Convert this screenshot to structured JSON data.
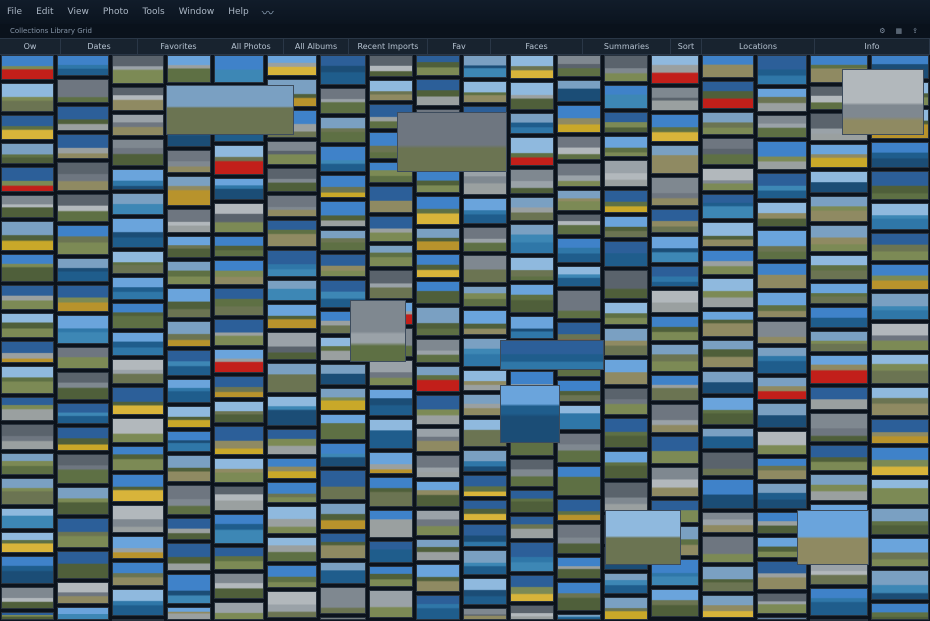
{
  "menu": [
    "File",
    "Edit",
    "View",
    "Photo",
    "Tools",
    "Window",
    "Help"
  ],
  "infobar": {
    "status": "Collections  Library  Grid",
    "icons": [
      "settings-icon",
      "grid-icon",
      "share-icon"
    ]
  },
  "columns": [
    "Ow",
    "Dates",
    "Favorites",
    "All Photos",
    "All Albums",
    "Recent Imports",
    "Fav",
    "Faces",
    "Summaries",
    "Sort",
    "Locations",
    "Info"
  ],
  "palettes": {
    "sky": [
      "#3f82c9",
      "#6aa4dc",
      "#8fb9de",
      "#2c5f99",
      "#7aa0c2"
    ],
    "sea": [
      "#1f5d8c",
      "#2f77a8",
      "#1b4d76",
      "#3d87b5"
    ],
    "land": [
      "#5e7044",
      "#7c8a55",
      "#4f5f3a",
      "#8f8a62",
      "#6b7452",
      "#9aa0a0"
    ],
    "gold": [
      "#c9a829",
      "#d8b43a",
      "#b8932c"
    ],
    "gray": [
      "#7f8890",
      "#9aa2a8",
      "#6e7680",
      "#b2b8bc",
      "#5a636c"
    ],
    "red": [
      "#c21f1a"
    ]
  }
}
